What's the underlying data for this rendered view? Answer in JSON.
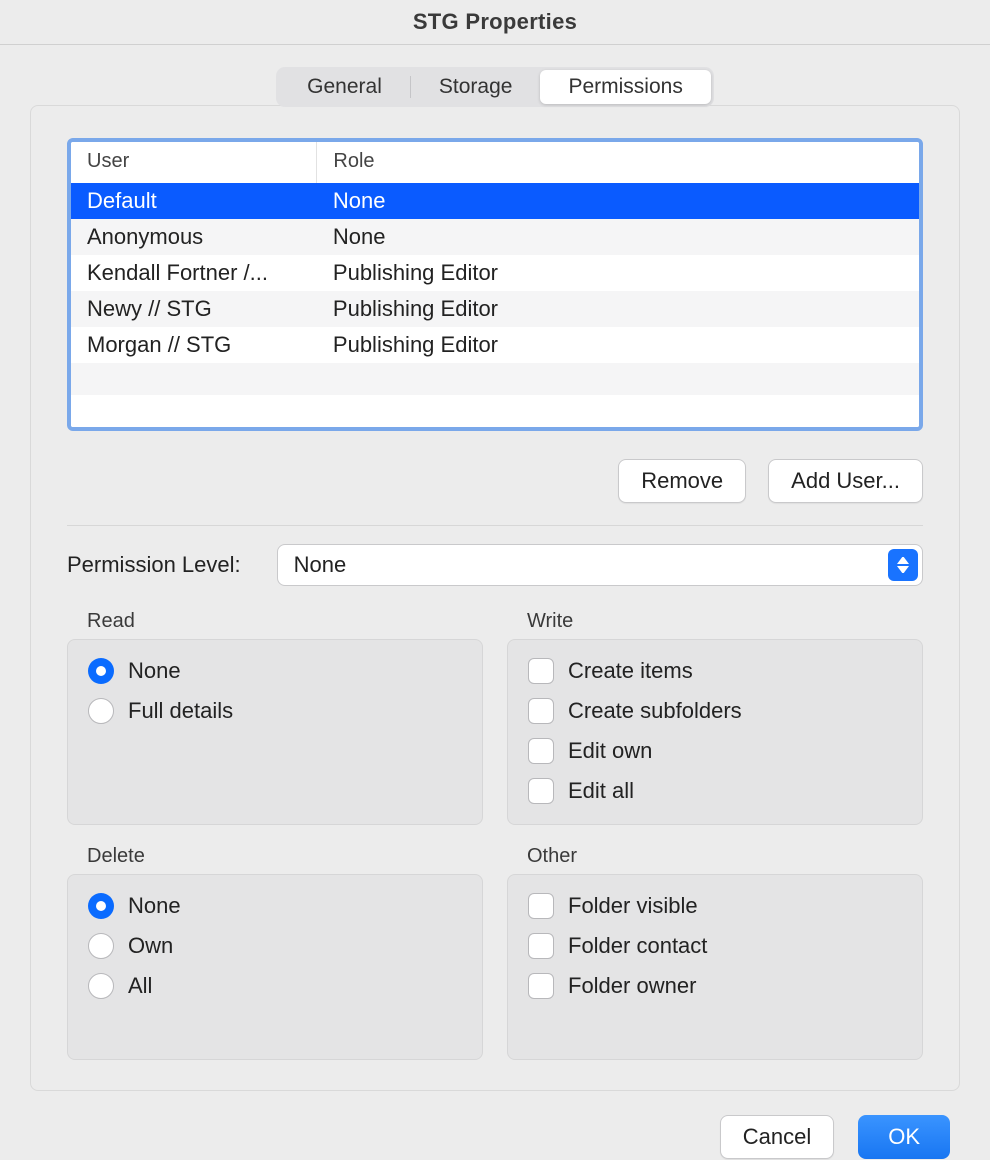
{
  "window": {
    "title": "STG Properties"
  },
  "tabs": {
    "items": [
      {
        "label": "General"
      },
      {
        "label": "Storage"
      },
      {
        "label": "Permissions"
      }
    ],
    "active_index": 2
  },
  "table": {
    "headers": {
      "user": "User",
      "role": "Role"
    },
    "rows": [
      {
        "user": "Default",
        "role": "None",
        "selected": true
      },
      {
        "user": "Anonymous",
        "role": "None",
        "selected": false
      },
      {
        "user": "Kendall Fortner /...",
        "role": "Publishing Editor",
        "selected": false
      },
      {
        "user": "Newy // STG",
        "role": "Publishing Editor",
        "selected": false
      },
      {
        "user": "Morgan // STG",
        "role": "Publishing Editor",
        "selected": false
      }
    ]
  },
  "buttons": {
    "remove": "Remove",
    "add_user": "Add User...",
    "cancel": "Cancel",
    "ok": "OK"
  },
  "permission_level": {
    "label": "Permission Level:",
    "value": "None"
  },
  "groups": {
    "read": {
      "title": "Read",
      "options": [
        {
          "label": "None",
          "checked": true
        },
        {
          "label": "Full details",
          "checked": false
        }
      ]
    },
    "write": {
      "title": "Write",
      "options": [
        {
          "label": "Create items",
          "checked": false
        },
        {
          "label": "Create subfolders",
          "checked": false
        },
        {
          "label": "Edit own",
          "checked": false
        },
        {
          "label": "Edit all",
          "checked": false
        }
      ]
    },
    "delete": {
      "title": "Delete",
      "options": [
        {
          "label": "None",
          "checked": true
        },
        {
          "label": "Own",
          "checked": false
        },
        {
          "label": "All",
          "checked": false
        }
      ]
    },
    "other": {
      "title": "Other",
      "options": [
        {
          "label": "Folder visible",
          "checked": false
        },
        {
          "label": "Folder contact",
          "checked": false
        },
        {
          "label": "Folder owner",
          "checked": false
        }
      ]
    }
  }
}
